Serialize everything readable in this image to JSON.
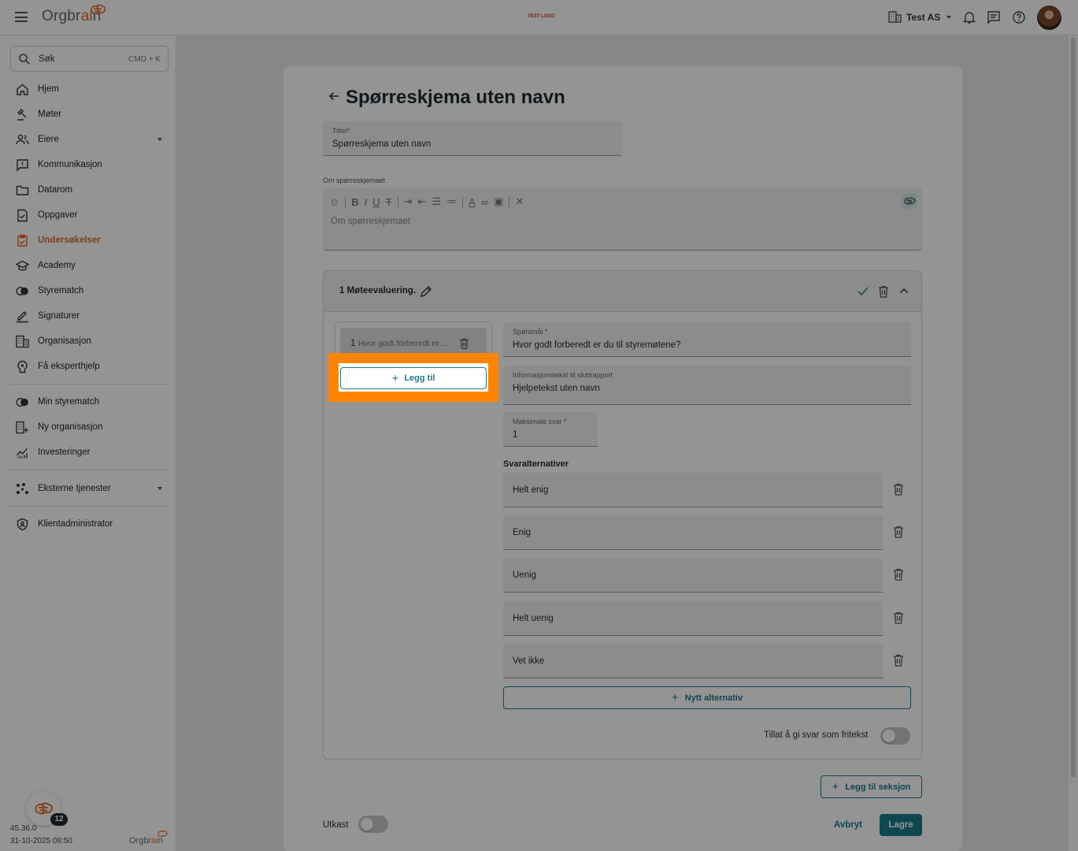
{
  "header": {
    "logo_prefix": "Orgbr",
    "logo_ai": "ai",
    "logo_suffix": "n",
    "test_logo": "TEST LOGO",
    "org_name": "Test AS"
  },
  "sidebar": {
    "search_label": "Søk",
    "search_shortcut": "CMD + K",
    "items": [
      {
        "label": "Hjem",
        "icon": "home-icon"
      },
      {
        "label": "Møter",
        "icon": "gavel-icon"
      },
      {
        "label": "Eiere",
        "icon": "people-icon"
      },
      {
        "label": "Kommunikasjon",
        "icon": "chat-icon"
      },
      {
        "label": "Datarom",
        "icon": "folder-icon"
      },
      {
        "label": "Oppgaver",
        "icon": "task-icon"
      },
      {
        "label": "Undersøkelser",
        "icon": "survey-icon"
      },
      {
        "label": "Academy",
        "icon": "academy-icon"
      },
      {
        "label": "Styrematch",
        "icon": "match-icon"
      },
      {
        "label": "Signaturer",
        "icon": "signature-icon"
      },
      {
        "label": "Organisasjon",
        "icon": "building-icon"
      },
      {
        "label": "Få eksperthjelp",
        "icon": "expert-icon"
      },
      {
        "label": "Min styrematch",
        "icon": "match-icon"
      },
      {
        "label": "Ny organisasjon",
        "icon": "building-add-icon"
      },
      {
        "label": "Investeringer",
        "icon": "chart-icon"
      },
      {
        "label": "Eksterne tjenester",
        "icon": "services-icon"
      },
      {
        "label": "Klientadministrator",
        "icon": "admin-icon"
      }
    ],
    "active_color": "#e06a2c",
    "version": "45.36.0",
    "date": "31-10-2025 08:50",
    "notification_count": "12",
    "brand_prefix": "Orgbr",
    "brand_ai": "ai",
    "brand_suffix": "n"
  },
  "form": {
    "page_title": "Spørreskjema uten navn",
    "title_label": "Tittel*",
    "title_value": "Spørreskjema uten navn",
    "about_label": "Om spørreskjemaet",
    "about_placeholder": "Om spørreskjemaet",
    "toolbar": {
      "bold": "B",
      "italic": "I",
      "underline": "U",
      "strike": "T"
    },
    "section_title": "1 Møteevaluering.",
    "question_number": "1",
    "question_preview": "Hvor godt forberedt er du til styremøtene?",
    "add_question_label": "Legg til",
    "question_label": "Spørsmål *",
    "question_value": "Hvor godt forberedt er du til styremøtene?",
    "info_label": "Informasjonstekst til sluttrapport",
    "info_value": "Hjelpetekst uten navn",
    "max_answers_label": "Maksimale svar *",
    "max_answers_value": "1",
    "alternatives_label": "Svaralternativer",
    "alternatives": [
      "Helt enig",
      "Enig",
      "Uenig",
      "Helt uenig",
      "Vet ikke"
    ],
    "new_alternative_label": "Nytt alternativ",
    "free_text_label": "Tillat å gi svar som fritekst",
    "add_section_label": "Legg til seksjon",
    "draft_label": "Utkast",
    "cancel_label": "Avbryt",
    "save_label": "Lagre",
    "accent_color": "#1b7a8c",
    "highlight_color": "#ff8400"
  }
}
